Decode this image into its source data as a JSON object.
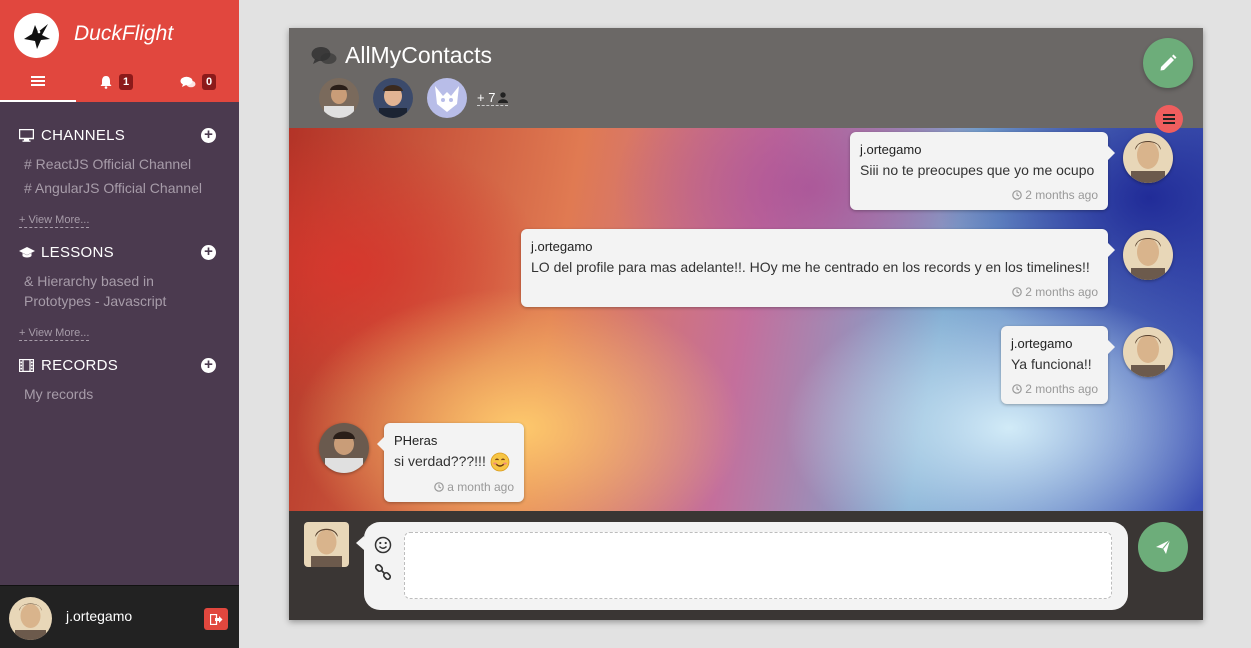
{
  "brand": {
    "title": "DuckFlight",
    "logo_icon": "bird-icon",
    "accent": "#e1473e"
  },
  "topnav": {
    "notifications_count": "1",
    "messages_count": "0"
  },
  "sidebar": {
    "channels": {
      "title": "CHANNELS",
      "items": [
        "# ReactJS Official Channel",
        "# AngularJS Official Channel"
      ],
      "view_more": "+ View More..."
    },
    "lessons": {
      "title": "LESSONS",
      "items": [
        "& Hierarchy based in Prototypes - Javascript"
      ],
      "view_more": "+ View More..."
    },
    "records": {
      "title": "RECORDS",
      "items": [
        "My records"
      ]
    }
  },
  "user": {
    "name": "j.ortegamo"
  },
  "chat": {
    "title": "AllMyContacts",
    "more_members": "+ 7",
    "messages": [
      {
        "author": "j.ortegamo",
        "text": "Siii no te preocupes que yo me ocupo",
        "time": "2 months ago",
        "side": "right"
      },
      {
        "author": "j.ortegamo",
        "text": "LO del profile para mas adelante!!. HOy me he centrado en los records y en los timelines!!",
        "time": "2 months ago",
        "side": "right"
      },
      {
        "author": "j.ortegamo",
        "text": "Ya funciona!!",
        "time": "2 months ago",
        "side": "right"
      },
      {
        "author": "PHeras",
        "text": "si verdad???!!! ",
        "time": "a month ago",
        "side": "left"
      }
    ],
    "composer": {
      "input_value": "",
      "placeholder": ""
    }
  },
  "colors": {
    "sidebar_bg": "#4b3a4f",
    "green_fab": "#6dad7a",
    "red_fab": "#ef5e5e",
    "header_bg": "#6b6866"
  }
}
